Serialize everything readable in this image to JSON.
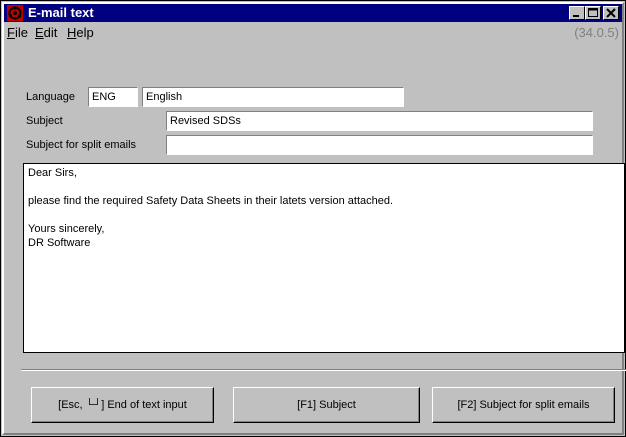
{
  "window": {
    "title": "E-mail text",
    "version": "(34.0.5)"
  },
  "menu": {
    "file": "File",
    "edit": "Edit",
    "help": "Help"
  },
  "form": {
    "language_label": "Language",
    "language_code": "ENG",
    "language_name": "English",
    "subject_label": "Subject",
    "subject_value": "Revised SDSs",
    "split_subject_label": "Subject for split emails",
    "split_subject_value": ""
  },
  "body_lines": [
    "Dear Sirs,",
    "",
    "please find the required Safety Data Sheets in their latets version attached.",
    "",
    "Yours sincerely,",
    "DR Software"
  ],
  "buttons": {
    "end_input": "[Esc, └┘] End of text input",
    "subject": "[F1] Subject",
    "split_subject": "[F2] Subject for split emails"
  },
  "colors": {
    "titlebar": "#000080",
    "face": "#c0c0c0",
    "version_text": "#808080"
  },
  "icons": {
    "app": "biohazard-icon",
    "minimize": "minimize-icon",
    "maximize": "maximize-icon",
    "close": "close-icon"
  }
}
